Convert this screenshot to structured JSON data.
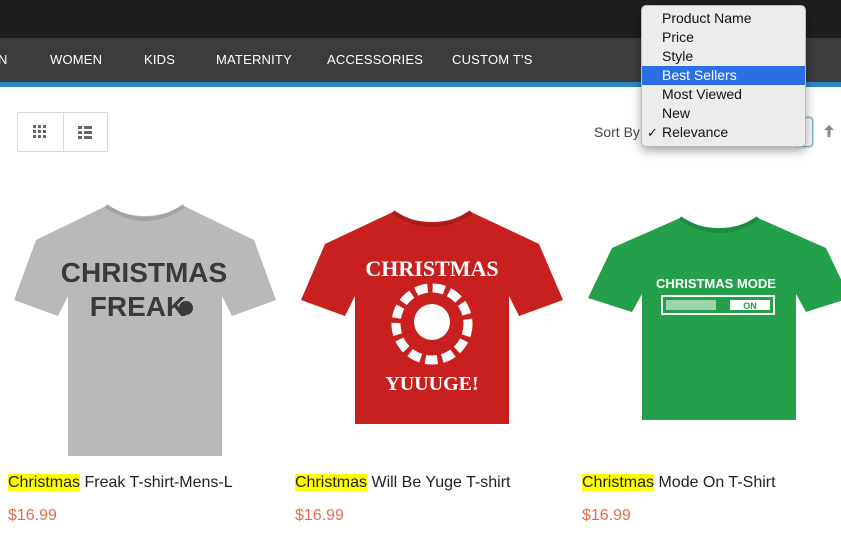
{
  "nav": {
    "items": [
      {
        "label": "N"
      },
      {
        "label": "WOMEN"
      },
      {
        "label": "KIDS"
      },
      {
        "label": "MATERNITY"
      },
      {
        "label": "ACCESSORIES"
      },
      {
        "label": "CUSTOM T'S"
      }
    ]
  },
  "toolbar": {
    "grid_view_icon": "grid-icon",
    "list_view_icon": "list-icon",
    "sort_label": "Sort By",
    "sort_direction_icon": "arrow-up-icon"
  },
  "sort_dropdown": {
    "options": [
      {
        "label": "Product Name",
        "check": ""
      },
      {
        "label": "Price",
        "check": ""
      },
      {
        "label": "Style",
        "check": ""
      },
      {
        "label": "Best Sellers",
        "check": ""
      },
      {
        "label": "Most Viewed",
        "check": ""
      },
      {
        "label": "New",
        "check": ""
      },
      {
        "label": "Relevance",
        "check": "✓"
      }
    ],
    "highlighted": "Best Sellers",
    "current": "Relevance"
  },
  "products": [
    {
      "highlight": "Christmas",
      "name_rest": " Freak T-shirt-Mens-L",
      "price": "$16.99",
      "shirt_color": "#b9b9b9",
      "print_color": "#3a3a3a",
      "print_line1": "CHRISTMAS",
      "print_line2": "FREAK"
    },
    {
      "highlight": "Christmas",
      "name_rest": " Will Be Yuge T-shirt",
      "price": "$16.99",
      "shirt_color": "#c8201f",
      "print_color": "#ffffff",
      "print_line1": "CHRISTMAS",
      "print_line2": "YUUUGE!"
    },
    {
      "highlight": "Christmas",
      "name_rest": " Mode On T-Shirt",
      "price": "$16.99",
      "shirt_color": "#24a04a",
      "print_color": "#ffffff",
      "print_line1": "CHRISTMAS MODE",
      "print_line2": "ON"
    }
  ],
  "colors": {
    "accent_blue": "#2d86c8",
    "price": "#e86a4c",
    "search_highlight": "#ffff00",
    "selected_option": "#2a6fe3"
  }
}
